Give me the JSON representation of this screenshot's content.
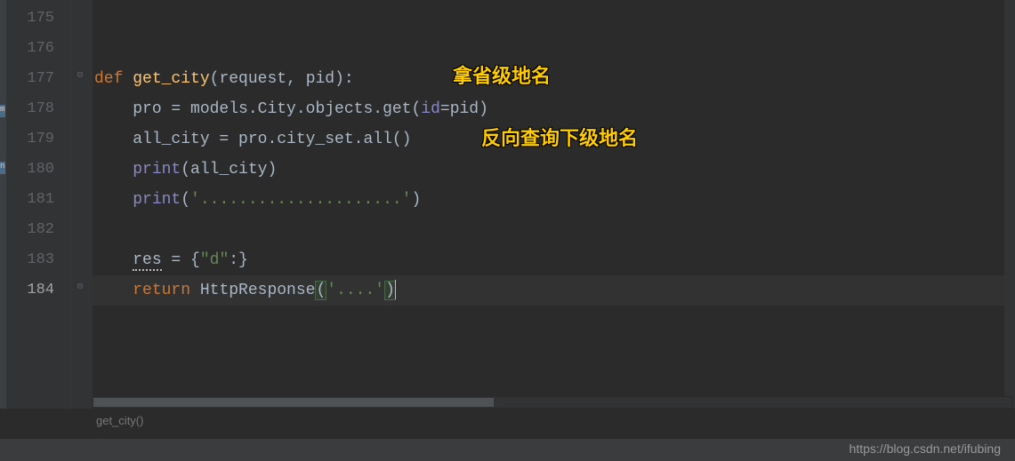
{
  "lines": {
    "start": 175,
    "end": 184
  },
  "code": {
    "l177_def": "def",
    "l177_fn": "get_city",
    "l177_sig_open": "(",
    "l177_p1": "request",
    "l177_comma": ", ",
    "l177_p2": "pid",
    "l177_sig_close": "):",
    "l178_var": "pro = models.City.objects.get(",
    "l178_id": "id",
    "l178_eq": "=pid)",
    "l179": "all_city = pro.city_set.all()",
    "l180_print": "print",
    "l180_arg": "(all_city)",
    "l181_print": "print",
    "l181_open": "(",
    "l181_str": "'.....................'",
    "l181_close": ")",
    "l183_res": "res",
    "l183_eq": " = {",
    "l183_key": "\"d\"",
    "l183_colon": ":}",
    "l184_return": "return",
    "l184_space": " ",
    "l184_http": "HttpResponse",
    "l184_open": "(",
    "l184_str": "'....'",
    "l184_close": ")"
  },
  "annotations": {
    "a1": "拿省级地名",
    "a2": "反向查询下级地名"
  },
  "breadcrumb": "get_city()",
  "watermark": "https://blog.csdn.net/ifubing"
}
